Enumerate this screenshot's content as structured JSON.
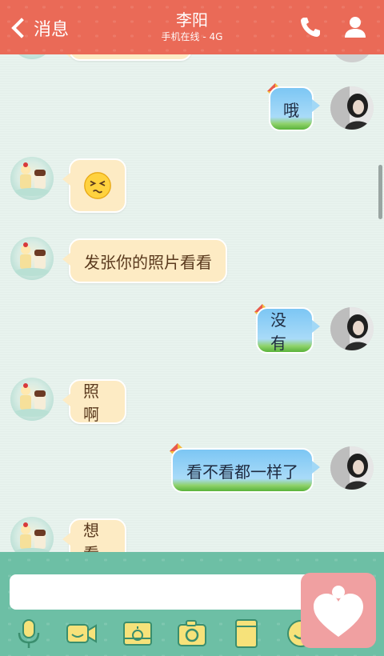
{
  "header": {
    "back_label": "消息",
    "title": "李阳",
    "subtitle": "手机在线 - 4G"
  },
  "messages": [
    {
      "side": "right",
      "text": "哦"
    },
    {
      "side": "left",
      "emoji": "confused-face-emoji"
    },
    {
      "side": "left",
      "text": "发张你的照片看看"
    },
    {
      "side": "right",
      "text": "没有"
    },
    {
      "side": "left",
      "text": "照啊"
    },
    {
      "side": "right",
      "text": "看不看都一样了"
    },
    {
      "side": "left",
      "text": "想看"
    }
  ],
  "composer": {
    "input_value": "",
    "input_placeholder": ""
  },
  "toolbar": {
    "icons": [
      "microphone-icon",
      "video-call-icon",
      "photo-album-icon",
      "camera-icon",
      "file-icon",
      "emoji-icon"
    ]
  },
  "colors": {
    "header": "#ea6a57",
    "chat_background": "#e8f3ee",
    "incoming_bubble": "#fdebc4",
    "outgoing_bubble": "#a9dbf8",
    "bottom_bar": "#6dbfa5",
    "heart_button": "#f0a0a1"
  }
}
